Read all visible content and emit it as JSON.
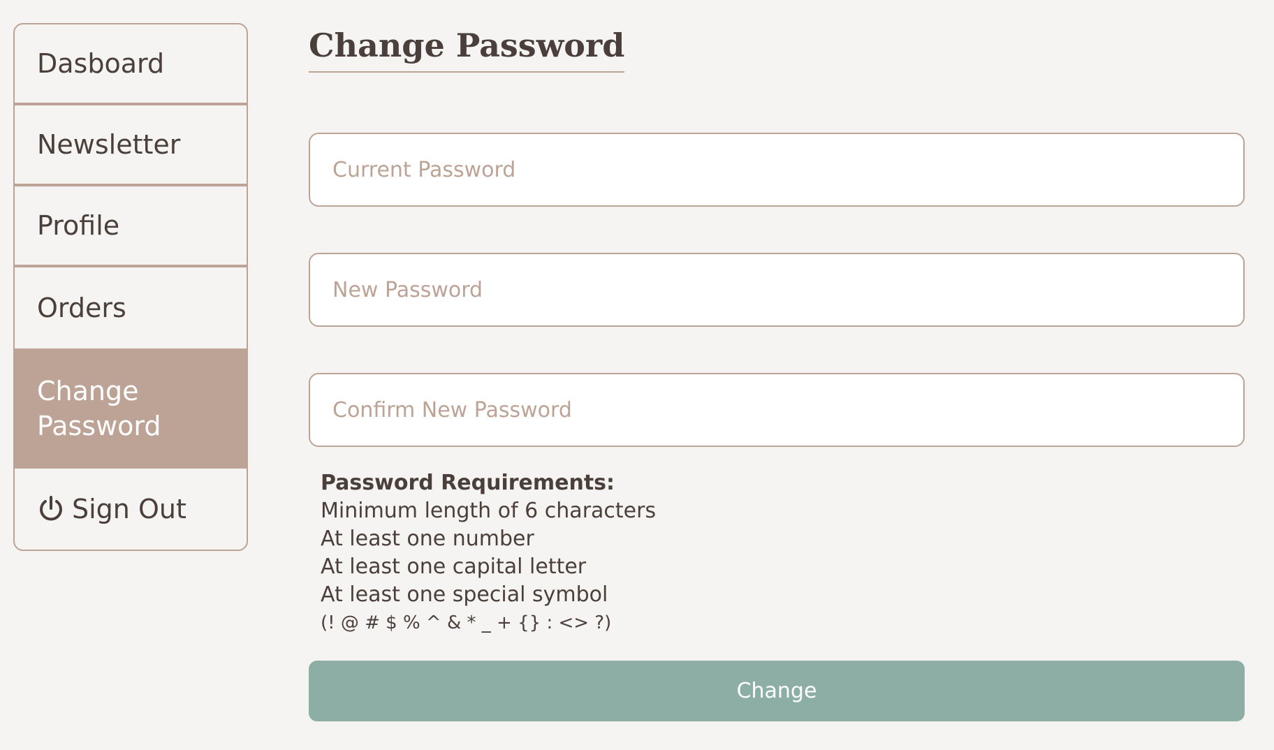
{
  "sidebar": {
    "items": [
      {
        "label": "Dasboard",
        "active": false
      },
      {
        "label": "Newsletter",
        "active": false
      },
      {
        "label": "Profile",
        "active": false
      },
      {
        "label": "Orders",
        "active": false
      },
      {
        "label": "Change Password",
        "active": true
      },
      {
        "label": "Sign Out",
        "icon": "power-icon",
        "active": false
      }
    ]
  },
  "main": {
    "title": "Change Password",
    "fields": {
      "current": {
        "placeholder": "Current Password",
        "value": ""
      },
      "new": {
        "placeholder": "New Password",
        "value": ""
      },
      "confirm": {
        "placeholder": "Confirm New Password",
        "value": ""
      }
    },
    "requirements": {
      "heading": "Password Requirements:",
      "items": [
        "Minimum length of 6 characters",
        "At least one number",
        "At least one capital letter",
        "At least one special symbol"
      ],
      "symbols": "(! @ # $ % ^ & * _ + {} : <> ?)"
    },
    "submit_label": "Change"
  },
  "colors": {
    "background": "#f6f4f2",
    "accent": "#bca396",
    "button": "#8caea4",
    "text": "#4a3f3b"
  }
}
